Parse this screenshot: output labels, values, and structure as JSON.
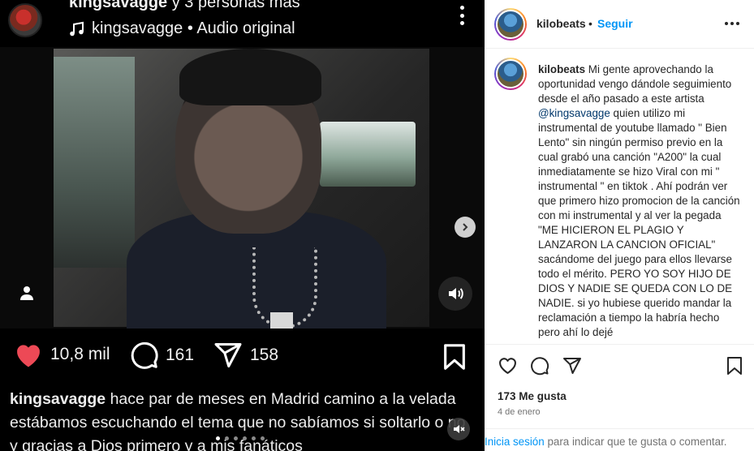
{
  "reel": {
    "owner_username": "kingsavagge",
    "owner_suffix": "y 3 personas más",
    "audio_label": "kingsavagge • Audio original",
    "likes_count": "10,8 mil",
    "comments_count": "161",
    "shares_count": "158",
    "caption_username": "kingsavagge",
    "caption_text": "hace par de meses  en Madrid camino a la velada estábamos escuchando el tema que no sabíamos si soltarlo o no y gracias a Dios primero y a mis fanáticos",
    "carousel_dots": 6,
    "carousel_active_index": 0
  },
  "post": {
    "username": "kilobeats",
    "separator": "•",
    "follow_label": "Seguir",
    "comment": {
      "username": "kilobeats",
      "text_before_mention": "Mi gente aprovechando la oportunidad vengo dándole seguimiento desde el año pasado a este artista",
      "mention": "@kingsavagge",
      "text_after_mention": "quien utilizo mi instrumental de youtube llamado \" Bien Lento\" sin ningún permiso previo en la cual grabó una canción \"A200\" la cual inmediatamente se hizo Viral con mi \" instrumental \" en tiktok . Ahí podrán ver que primero hizo promocion de la canción con mi instrumental y al ver la pegada \"ME HICIERON EL PLAGIO Y LANZARON LA CANCION OFICIAL\" sacándome del juego para ellos llevarse todo el mérito. PERO YO SOY HIJO DE DIOS Y NADIE SE QUEDA CON LO DE NADIE. si yo hubiese querido mandar la reclamación a tiempo la habría hecho pero ahí lo dejé"
    },
    "likes_label": "173 Me gusta",
    "date_label": "4 de enero",
    "login_link": "Inicia sesión",
    "login_rest": "para indicar que te gusta o comentar."
  },
  "colors": {
    "like_red": "#ed4956",
    "link_blue": "#0095f6",
    "mention_blue": "#00376b",
    "dark_bg": "#000000"
  },
  "icons": [
    "music-note-icon",
    "more-vertical-icon",
    "heart-filled-icon",
    "comment-icon",
    "share-icon",
    "bookmark-icon",
    "next-arrow-icon",
    "sound-icon",
    "user-tag-icon",
    "more-horizontal-icon",
    "heart-outline-icon"
  ]
}
